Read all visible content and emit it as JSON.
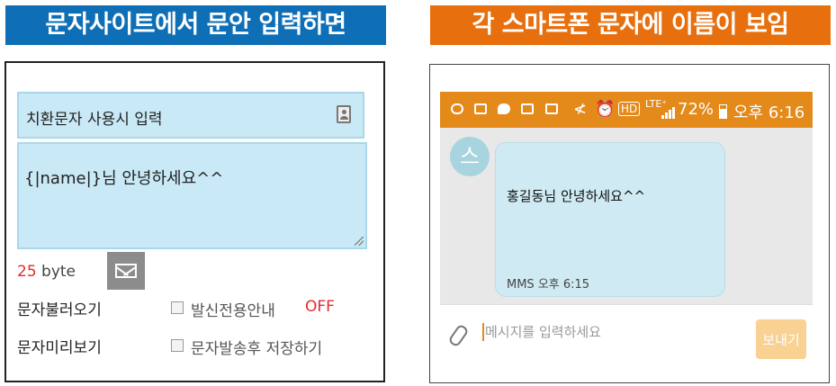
{
  "left_banner": {
    "title": "문자사이트에서 문안 입력하면",
    "color": "#0f6fb6"
  },
  "right_banner": {
    "title": "각 스마트폰 문자에 이름이 보임",
    "color": "#e76f0e"
  },
  "compose": {
    "substitution_label": "치환문자 사용시 입력",
    "message_text": "{|name|}님 안녕하세요^^",
    "byte_count": "25",
    "byte_unit": " byte",
    "load_messages": "문자불러오기",
    "preview_message": "문자미리보기",
    "sender_guide": "발신전용안내",
    "sender_guide_status": "OFF",
    "save_after_send": "문자발송후 저장하기"
  },
  "phone": {
    "status_bar": {
      "mute_icon": "≮",
      "alarm_icon": "⏰",
      "hd": "HD",
      "lte": "LTE⁺",
      "battery": "72%",
      "time": "오후 6:16",
      "color": "#e38a1a"
    },
    "avatar_letter": "스",
    "message": "홍길동님 안녕하세요^^",
    "message_meta": "MMS 오후 6:15",
    "input_placeholder": "메시지를 입력하세요",
    "send_label": "보내기"
  }
}
